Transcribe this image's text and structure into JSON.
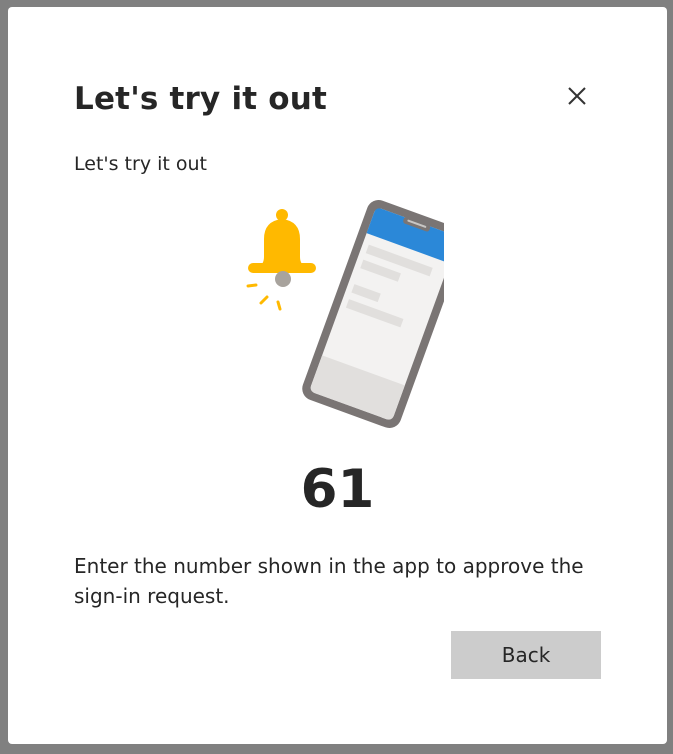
{
  "dialog": {
    "title": "Let's try it out",
    "subtitle": "Let's try it out",
    "number": "61",
    "instruction": "Enter the number shown in the app to approve the sign-in request.",
    "back_label": "Back",
    "close_icon": "close-icon"
  },
  "illustration": {
    "bell_icon": "bell-icon",
    "phone_icon": "phone-icon",
    "colors": {
      "bell": "#FFB900",
      "phone_header": "#2B88D8",
      "phone_frame": "#7A7574"
    }
  }
}
